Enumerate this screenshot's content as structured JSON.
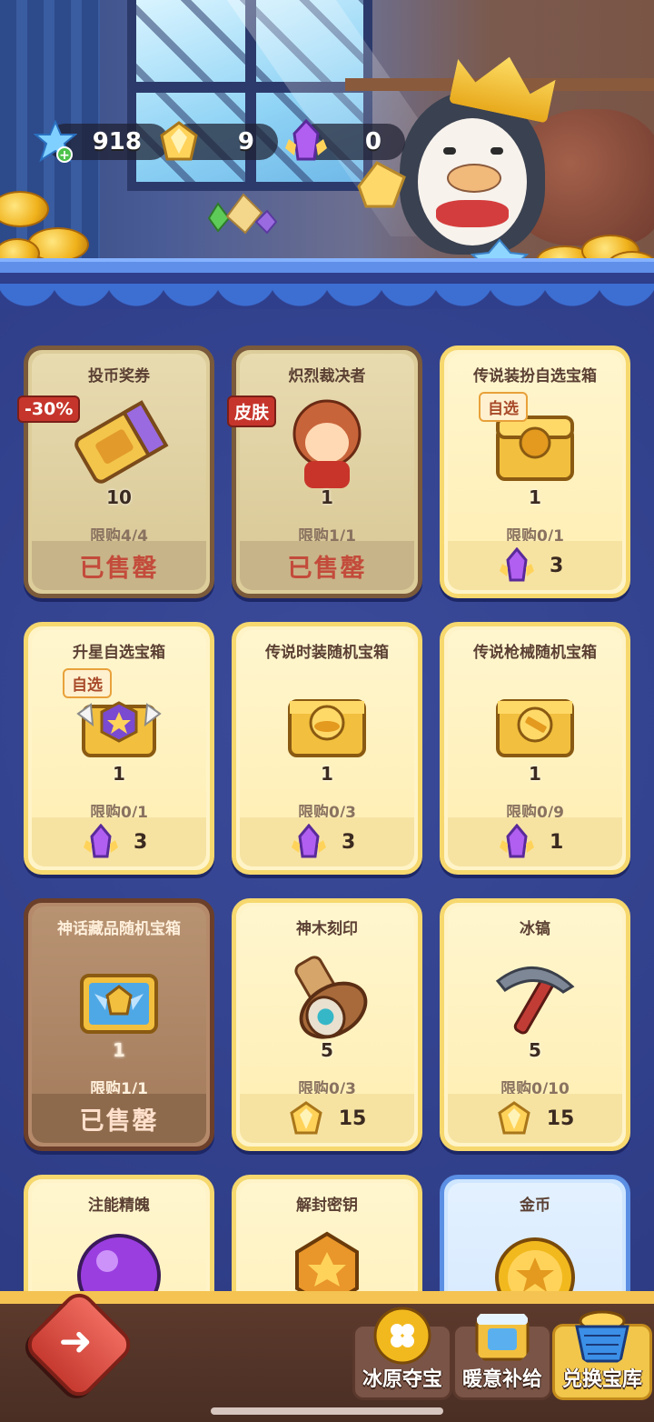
{
  "currencies": [
    {
      "icon": "snowflake-gem-icon",
      "value": "918"
    },
    {
      "icon": "gold-crystal-icon",
      "value": "9"
    },
    {
      "icon": "purple-crystal-icon",
      "value": "0"
    }
  ],
  "items": [
    {
      "title": "投币奖券",
      "qty": "10",
      "limit": "限购4/4",
      "sold_out": "已售罄",
      "badge": "-30%",
      "art": "ticket-icon",
      "state": "sold"
    },
    {
      "title": "炽烈裁决者",
      "qty": "1",
      "limit": "限购1/1",
      "sold_out": "已售罄",
      "badge": "皮肤",
      "art": "hero-skin-icon",
      "state": "sold"
    },
    {
      "title": "传说装扮自选宝箱",
      "qty": "1",
      "limit": "限购0/1",
      "tag": "自选",
      "price": "3",
      "currency": "purple-crystal-icon",
      "art": "gold-chest-icon"
    },
    {
      "title": "升星自选宝箱",
      "qty": "1",
      "limit": "限购0/1",
      "tag": "自选",
      "price": "3",
      "currency": "purple-crystal-icon",
      "art": "star-chest-icon"
    },
    {
      "title": "传说时装随机宝箱",
      "qty": "1",
      "limit": "限购0/3",
      "price": "3",
      "currency": "purple-crystal-icon",
      "art": "hat-chest-icon"
    },
    {
      "title": "传说枪械随机宝箱",
      "qty": "1",
      "limit": "限购0/9",
      "price": "1",
      "currency": "purple-crystal-icon",
      "art": "gun-chest-icon"
    },
    {
      "title": "神话藏品随机宝箱",
      "qty": "1",
      "limit": "限购1/1",
      "sold_out": "已售罄",
      "art": "mythic-chest-icon",
      "state": "sold-brown"
    },
    {
      "title": "神木刻印",
      "qty": "5",
      "limit": "限购0/3",
      "price": "15",
      "currency": "gold-crystal-icon",
      "art": "wood-seal-icon"
    },
    {
      "title": "冰镐",
      "qty": "5",
      "limit": "限购0/10",
      "price": "15",
      "currency": "gold-crystal-icon",
      "art": "pickaxe-icon"
    },
    {
      "title": "注能精魄",
      "art": "purple-orb-icon"
    },
    {
      "title": "解封密钥",
      "art": "key-icon"
    },
    {
      "title": "金币",
      "art": "gold-coin-icon",
      "state": "blue"
    }
  ],
  "nav": {
    "back": "back-arrow-icon",
    "tabs": [
      {
        "label": "冰原夺宝",
        "icon": "clover-coin-icon",
        "active": false
      },
      {
        "label": "暖意补给",
        "icon": "crate-icon",
        "active": false
      },
      {
        "label": "兑换宝库",
        "icon": "coin-basket-icon",
        "active": true
      }
    ]
  },
  "colors": {
    "sold_text": "#c34b3b",
    "card_border": "#f6d86e",
    "bg": "#2f3f8c"
  }
}
